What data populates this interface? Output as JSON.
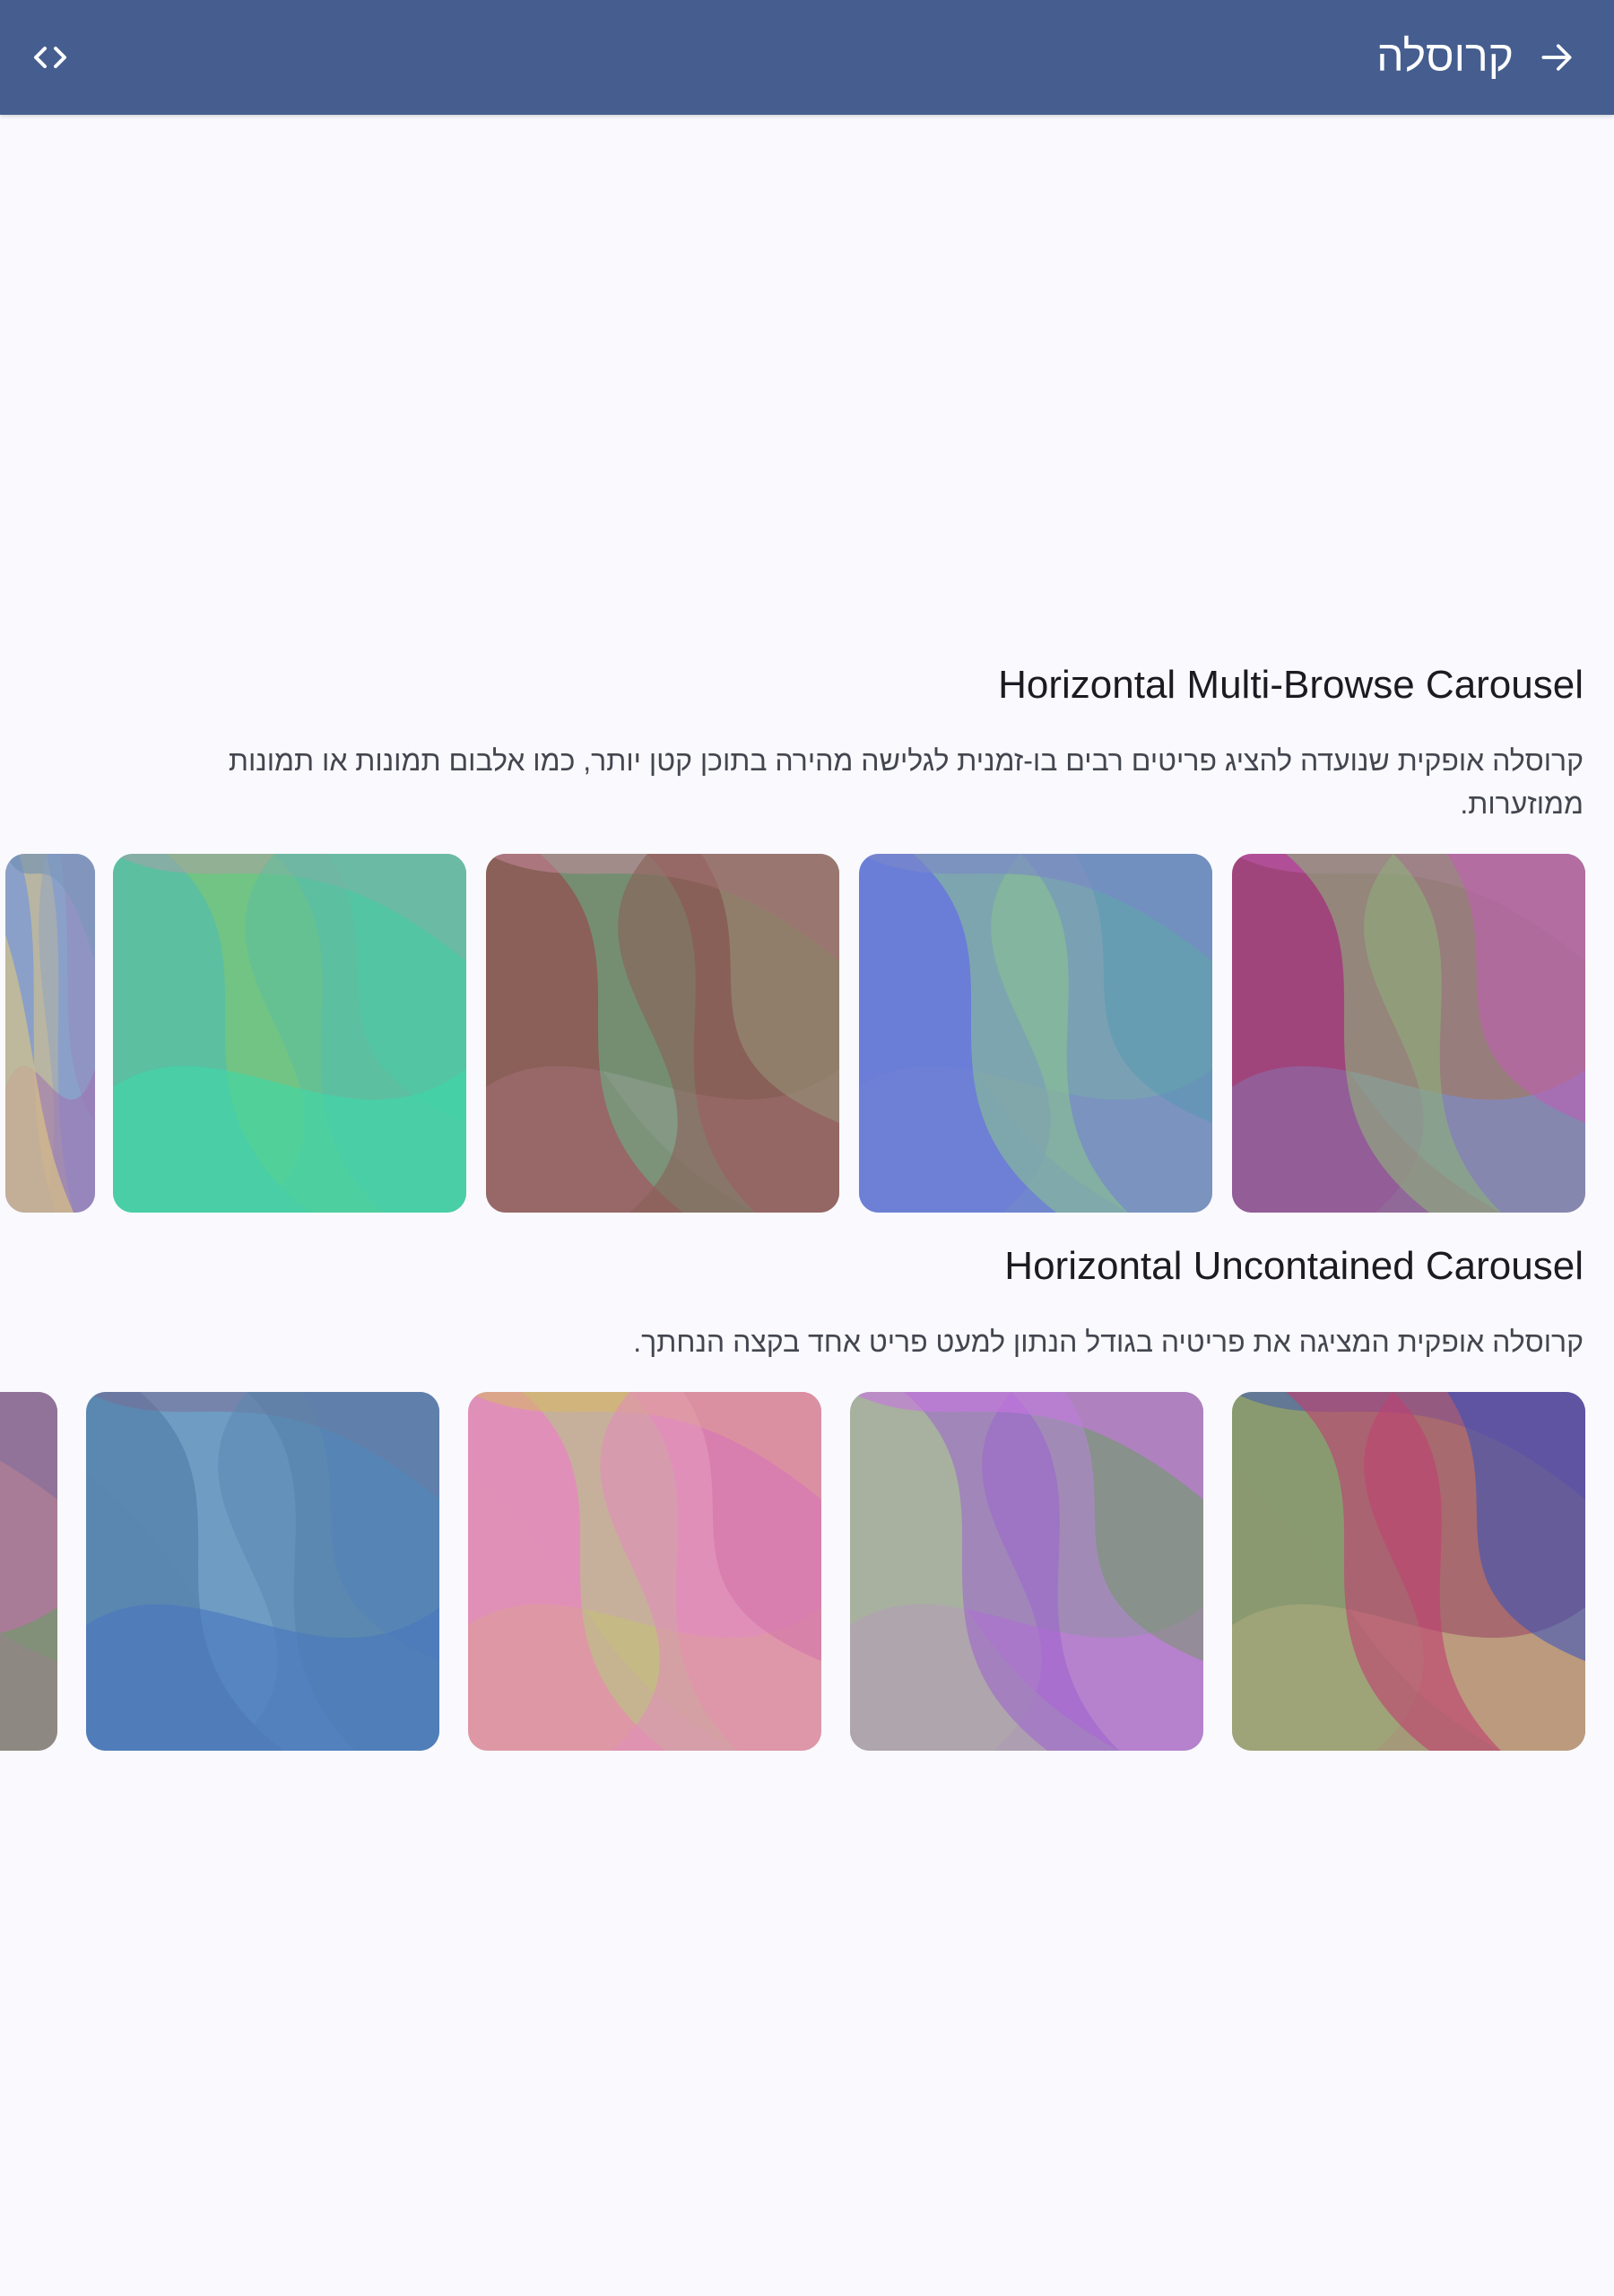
{
  "topbar": {
    "title": "קרוסלה",
    "back_icon": "arrow-forward-icon",
    "code_icon": "code-icon",
    "background": "#455e8f"
  },
  "sections": [
    {
      "title": "Horizontal Multi-Browse Carousel",
      "description": "קרוסלה אופקית שנועדה להציג פריטים רבים בו-זמנית לגלישה מהירה בתוכן קטן יותר, כמו אלבום תמונות או תמונות ממוזערות."
    },
    {
      "title": "Horizontal Uncontained Carousel",
      "description": "קרוסלה אופקית המציגה את פריטיה בגודל הנתון למעט פריט אחד בקצה הנחתך."
    }
  ],
  "palette": {
    "multi_browse": [
      [
        "#a0457c",
        "#c45bb8",
        "#8fb07a",
        "#7a8fd0"
      ],
      [
        "#6a7ed8",
        "#4d9ab0",
        "#8ec98a",
        "#7a88c8"
      ],
      [
        "#8a6058",
        "#a8e0a8",
        "#5cc890",
        "#c88aa0"
      ],
      [
        "#5cbfa0",
        "#3ed8a8",
        "#80c870",
        "#b89aa8"
      ],
      [
        "#8aa0c8",
        "#a070b0",
        "#e0c880",
        "#6f90b0"
      ]
    ],
    "uncontained": [
      [
        "#8a9a70",
        "#3050c0",
        "#c04070",
        "#c8b888"
      ],
      [
        "#a8b0a0",
        "#6a9a58",
        "#9a60d0",
        "#c878e0"
      ],
      [
        "#e090b8",
        "#c04a90",
        "#a8d878",
        "#d8b860"
      ],
      [
        "#5a88b0",
        "#4a78c0",
        "#7aa8d0",
        "#806890"
      ],
      [
        "#c070a8",
        "#60a060",
        "#8050a0",
        "#506890"
      ]
    ]
  }
}
